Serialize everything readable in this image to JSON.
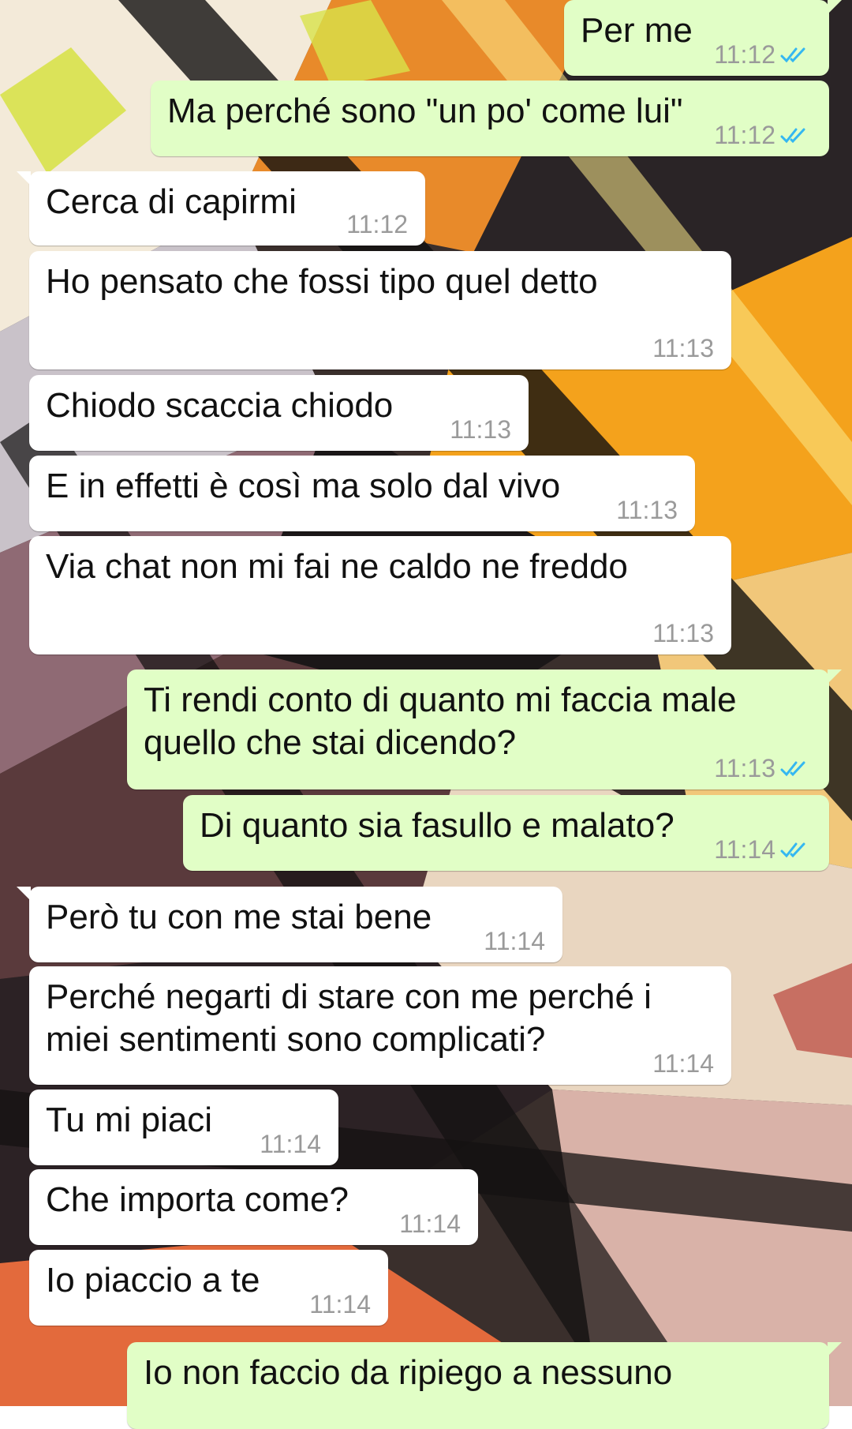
{
  "colors": {
    "incoming_bubble": "#ffffff",
    "outgoing_bubble": "#e1fec6",
    "time_text": "#9a9a9a",
    "read_ticks": "#34b7f1"
  },
  "chat": {
    "messages": [
      {
        "direction": "out",
        "text": "Per me",
        "time": "11:12",
        "status": "read-double-tick-icon"
      },
      {
        "direction": "out",
        "text": "Ma perché sono \"un po' come lui\"",
        "time": "11:12",
        "status": "read-double-tick-icon"
      },
      {
        "direction": "in",
        "text": "Cerca di capirmi",
        "time": "11:12"
      },
      {
        "direction": "in",
        "text": "Ho pensato che fossi tipo quel detto",
        "time": "11:13"
      },
      {
        "direction": "in",
        "text": "Chiodo scaccia chiodo",
        "time": "11:13"
      },
      {
        "direction": "in",
        "text": "E in effetti è così ma solo dal vivo",
        "time": "11:13"
      },
      {
        "direction": "in",
        "text": "Via chat non mi fai ne caldo ne freddo",
        "time": "11:13"
      },
      {
        "direction": "out",
        "text": "Ti rendi conto di quanto mi faccia male quello che stai dicendo?",
        "time": "11:13",
        "status": "read-double-tick-icon"
      },
      {
        "direction": "out",
        "text": "Di quanto sia fasullo e malato?",
        "time": "11:14",
        "status": "read-double-tick-icon"
      },
      {
        "direction": "in",
        "text": "Però tu con me stai bene",
        "time": "11:14"
      },
      {
        "direction": "in",
        "text": "Perché negarti di stare con me perché i miei sentimenti sono complicati?",
        "time": "11:14"
      },
      {
        "direction": "in",
        "text": "Tu mi piaci",
        "time": "11:14"
      },
      {
        "direction": "in",
        "text": "Che importa come?",
        "time": "11:14"
      },
      {
        "direction": "in",
        "text": "Io piaccio a te",
        "time": "11:14"
      },
      {
        "direction": "out",
        "text": "Io non faccio da ripiego a nessuno",
        "time": ""
      }
    ]
  }
}
